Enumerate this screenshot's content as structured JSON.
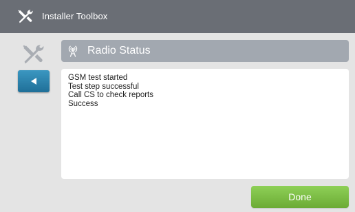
{
  "app": {
    "title": "Installer Toolbox"
  },
  "panel": {
    "title": "Radio Status",
    "icon": "radio-antenna-icon"
  },
  "log": {
    "lines": [
      "GSM test started",
      "Test step successful",
      "Call CS to check reports",
      "Success"
    ]
  },
  "nav": {
    "back_icon": "back-arrow-icon",
    "tools_icon": "tools-icon"
  },
  "actions": {
    "done_label": "Done"
  },
  "colors": {
    "titlebar": "#6a6e75",
    "back_button": "#2a82ad",
    "done_button": "#7dbe46",
    "panel_header": "#a2a8b0"
  }
}
